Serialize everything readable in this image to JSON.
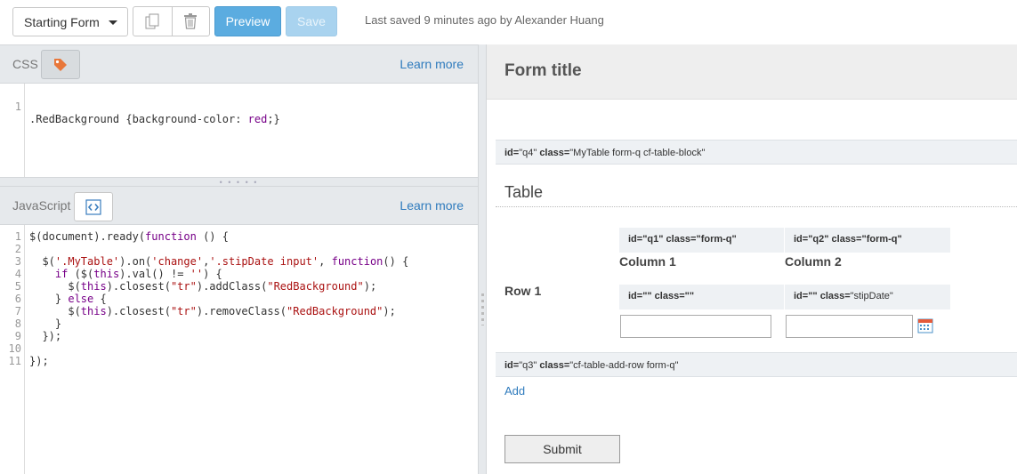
{
  "toolbar": {
    "form_select": "Starting Form",
    "preview_label": "Preview",
    "save_label": "Save",
    "last_saved": "Last saved 9 minutes ago by Alexander Huang"
  },
  "css_pane": {
    "title": "CSS",
    "learn_more": "Learn more",
    "line_numbers": [
      "1"
    ],
    "lines": [
      ".RedBackground {background-color: red;}"
    ]
  },
  "js_pane": {
    "title": "JavaScript",
    "learn_more": "Learn more",
    "line_numbers": [
      "1",
      "2",
      "3",
      "4",
      "5",
      "6",
      "7",
      "8",
      "9",
      "10",
      "11"
    ],
    "lines": [
      "$(document).ready(function () {",
      "",
      "  $('.MyTable').on('change','.stipDate input', function() {",
      "    if ($(this).val() != '') {",
      "      $(this).closest(\"tr\").addClass(\"RedBackground\");",
      "    } else {",
      "      $(this).closest(\"tr\").removeClass(\"RedBackground\");",
      "    }",
      "  });",
      "",
      "});"
    ]
  },
  "preview": {
    "form_title": "Form title",
    "q4_bar": {
      "id_key": "id=",
      "id_val": "\"q4\"",
      "class_key": "class=",
      "class_val": "\"MyTable form-q cf-table-block\""
    },
    "table_title": "Table",
    "col1_bar": "id=\"q1\" class=\"form-q\"",
    "col2_bar": "id=\"q2\" class=\"form-q\"",
    "col1_header": "Column 1",
    "col2_header": "Column 2",
    "row1_header": "Row 1",
    "cell1_bar": "id=\"\" class=\"\"",
    "cell2_bar_id": "id=\"\"",
    "cell2_bar_class_key": "class=",
    "cell2_bar_class_val": "\"stipDate\"",
    "q3_bar": {
      "id_key": "id=",
      "id_val": "\"q3\"",
      "class_key": "class=",
      "class_val": "\"cf-table-add-row form-q\""
    },
    "add_label": "Add",
    "submit_label": "Submit"
  },
  "colors": {
    "accent": "#5bace0",
    "link": "#2f7bbd",
    "tag_icon": "#e8773a"
  },
  "icons": [
    "copy-icon",
    "trash-icon",
    "tag-icon",
    "code-icon",
    "calendar-icon",
    "chevron-down-icon"
  ]
}
